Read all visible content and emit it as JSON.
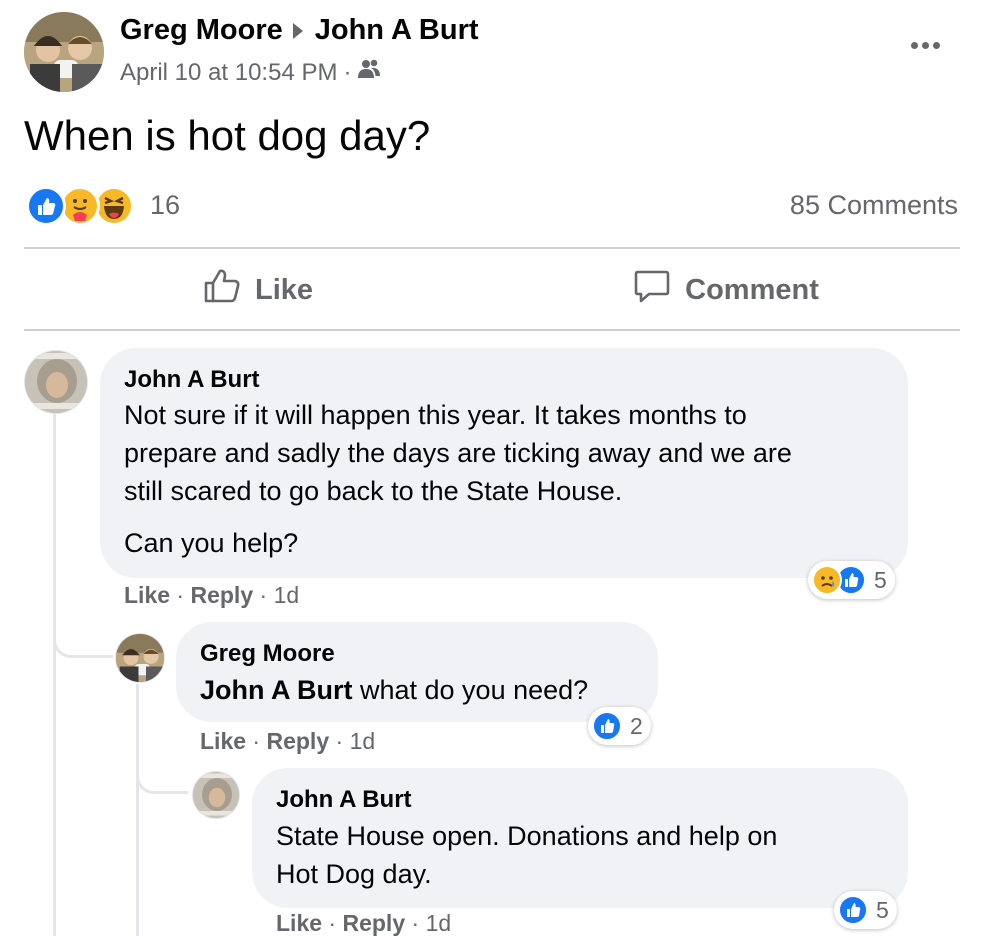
{
  "post": {
    "author": "Greg Moore",
    "recipient": "John A Burt",
    "date": "April 10 at 10:54 PM",
    "meta_sep": "·",
    "audience_icon": "friends-icon",
    "text": "When is hot dog day?",
    "reaction_count": "16",
    "comments_count": "85 Comments",
    "reactions": [
      "like",
      "care",
      "haha"
    ]
  },
  "actions": {
    "like_label": "Like",
    "comment_label": "Comment"
  },
  "comments": [
    {
      "author": "John A Burt",
      "lines": [
        "Not sure if it will happen this year. It takes months to",
        "prepare and sadly the days are ticking away and we are",
        "still scared to go back to the State House."
      ],
      "line2": "Can you help?",
      "like": "Like",
      "sep": "·",
      "reply": "Reply",
      "age": "1d",
      "reaction_count": "5",
      "reactions": [
        "sad",
        "like"
      ]
    },
    {
      "author": "Greg Moore",
      "mention": "John A Burt",
      "text": " what do you need?",
      "like": "Like",
      "sep": "·",
      "reply": "Reply",
      "age": "1d",
      "reaction_count": "2",
      "reactions": [
        "like"
      ]
    },
    {
      "author": "John A Burt",
      "lines": [
        "State House open. Donations and help on",
        "Hot Dog day."
      ],
      "like": "Like",
      "sep": "·",
      "reply": "Reply",
      "age": "1d",
      "reaction_count": "5",
      "reactions": [
        "like"
      ]
    }
  ],
  "colors": {
    "like_blue": "#1877f2",
    "haha_yellow": "#f7b928",
    "text_secondary": "#65676b",
    "bubble_bg": "#f0f2f5"
  }
}
